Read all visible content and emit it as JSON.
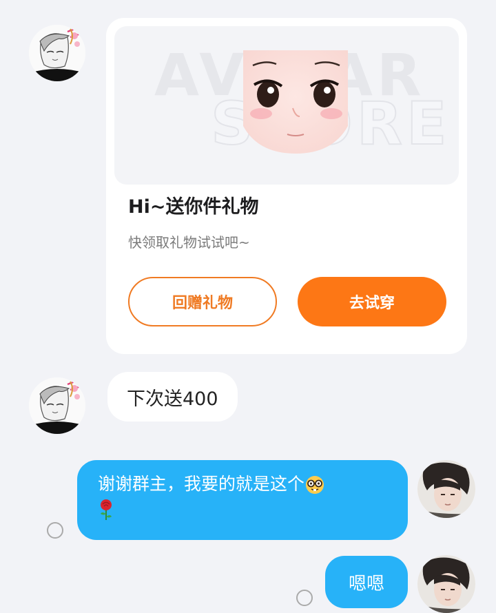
{
  "gift_card": {
    "banner_watermark_line1": "AVATAR",
    "banner_watermark_line2": "STORE",
    "title": "Hi~送你件礼物",
    "subtitle": "快领取礼物试试吧~",
    "return_gift_label": "回赠礼物",
    "try_on_label": "去试穿",
    "accent_color": "#fd7715"
  },
  "messages": [
    {
      "side": "left",
      "text": "下次送400",
      "icon": "sketch-avatar"
    },
    {
      "side": "right",
      "text": "谢谢群主，我要的就是这个",
      "emoji": [
        "nerd-face-icon",
        "rose-icon"
      ],
      "status_icon": "unread-circle-icon"
    },
    {
      "side": "right",
      "text": "嗯嗯",
      "status_icon": "unread-circle-icon"
    }
  ],
  "colors": {
    "background": "#f2f3f7",
    "my_bubble": "#27b2f8",
    "their_bubble": "#ffffff"
  }
}
